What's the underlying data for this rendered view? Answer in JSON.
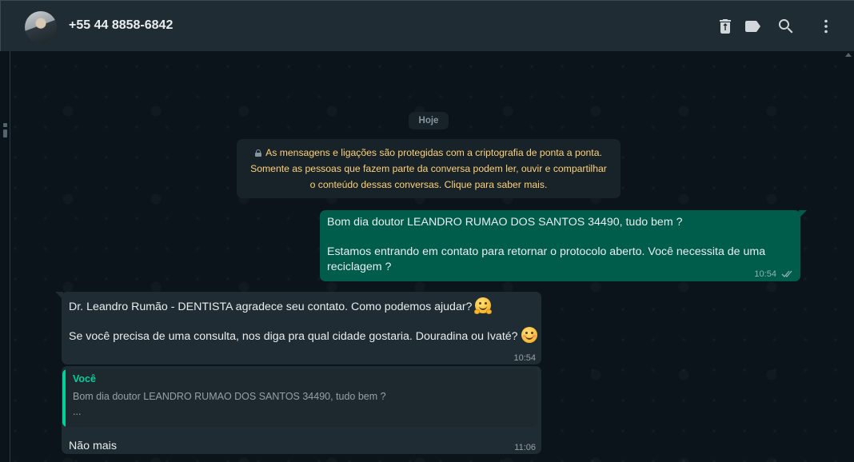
{
  "header": {
    "contact_name": "+55 44 8858-6842",
    "icons": [
      "delete-icon",
      "label-icon",
      "search-icon",
      "menu-icon"
    ]
  },
  "chat": {
    "date_label": "Hoje",
    "encryption_notice": {
      "line1": "As mensagens e ligações são protegidas com a criptografia de ponta a ponta.",
      "line2": "Somente as pessoas que fazem parte da conversa podem ler, ouvir e compartilhar",
      "line3": "o conteúdo dessas conversas. Clique para saber mais."
    },
    "messages": [
      {
        "direction": "outgoing",
        "line1": "Bom dia doutor LEANDRO RUMAO DOS SANTOS 34490, tudo bem ?",
        "line2": "Estamos entrando em contato para retornar o protocolo aberto. Você necessita de uma",
        "line3": "reciclagem ?",
        "time": "10:54",
        "status": "read"
      },
      {
        "direction": "incoming",
        "line1": "Dr. Leandro Rumão - DENTISTA agradece seu contato. Como podemos ajudar?",
        "line2": "Se você precisa de uma consulta, nos diga pra qual cidade gostaria. Douradina ou Ivaté?",
        "time": "10:54"
      },
      {
        "direction": "incoming",
        "quote_author": "Você",
        "quote_text": "Bom dia doutor LEANDRO RUMAO DOS SANTOS 34490, tudo bem ?",
        "quote_more": "...",
        "text": "Não mais",
        "time": "11:06"
      }
    ]
  },
  "colors": {
    "header_bg": "#202c33",
    "chat_bg": "#0b141a",
    "outgoing_bubble": "#005c4b",
    "incoming_bubble": "#202c33",
    "notice_text": "#ffd279",
    "quote_accent": "#06cf9c"
  }
}
